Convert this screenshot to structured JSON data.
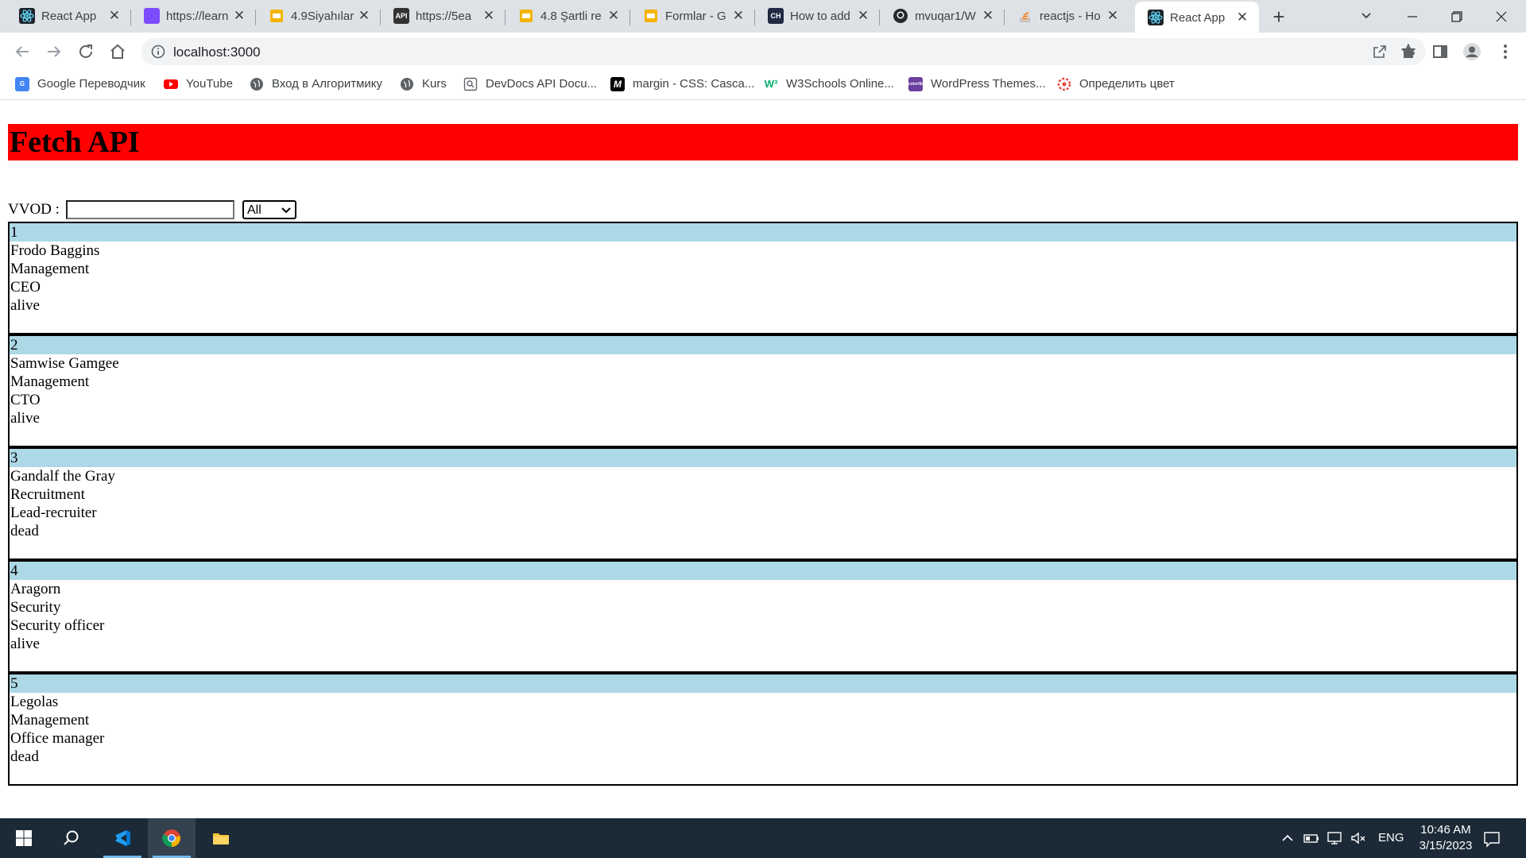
{
  "browser": {
    "tabs": [
      {
        "title": "React App",
        "favicon": "react-icon",
        "color": "#20232a"
      },
      {
        "title": "https://learn",
        "favicon": "purple-square-icon",
        "color": "#7c4dff"
      },
      {
        "title": "4.9Siyahılar",
        "favicon": "google-slides-icon",
        "color": "#f4b400"
      },
      {
        "title": "https://5ea",
        "favicon": "mock-api-icon",
        "color": "#333333"
      },
      {
        "title": "4.8 Şartli re",
        "favicon": "google-slides-icon",
        "color": "#f4b400"
      },
      {
        "title": "Formlar - G",
        "favicon": "google-slides-icon",
        "color": "#f4b400"
      },
      {
        "title": "How to add",
        "favicon": "ch-icon",
        "color": "#1f2a44"
      },
      {
        "title": "mvuqar1/W",
        "favicon": "github-icon",
        "color": "#24292e"
      },
      {
        "title": "reactjs - Ho",
        "favicon": "stackoverflow-icon",
        "color": "#f48024"
      },
      {
        "title": "React App",
        "favicon": "react-icon",
        "color": "#20232a",
        "active": true
      }
    ],
    "address_bar": {
      "url": "localhost:3000"
    },
    "bookmarks": [
      {
        "label": "Google Переводчик",
        "icon": "google-translate-icon",
        "color": "#4285f4"
      },
      {
        "label": "YouTube",
        "icon": "youtube-icon",
        "color": "#ff0000"
      },
      {
        "label": "Вход в Алгоритмику",
        "icon": "globe-icon",
        "color": "#5f6368"
      },
      {
        "label": "Kurs",
        "icon": "globe-icon",
        "color": "#5f6368"
      },
      {
        "label": "DevDocs API Docu...",
        "icon": "devdocs-icon",
        "color": "#5f6368"
      },
      {
        "label": "margin - CSS: Casca...",
        "icon": "mdn-icon",
        "color": "#000000"
      },
      {
        "label": "W3Schools Online...",
        "icon": "w3schools-icon",
        "color": "#04aa6d"
      },
      {
        "label": "WordPress Themes...",
        "icon": "colorlib-icon",
        "color": "#6a3f9e"
      },
      {
        "label": "Определить цвет",
        "icon": "color-picker-icon",
        "color": "#e8453c"
      }
    ]
  },
  "page": {
    "title": "Fetch API",
    "title_bg": "#ff0000",
    "filter": {
      "label": "VVOD :",
      "input_value": "",
      "select_value": "All"
    },
    "card_header_bg": "#add8e6",
    "employees": [
      {
        "id": "1",
        "name": "Frodo Baggins",
        "department": "Management",
        "position": "CEO",
        "status": "alive"
      },
      {
        "id": "2",
        "name": "Samwise Gamgee",
        "department": "Management",
        "position": "CTO",
        "status": "alive"
      },
      {
        "id": "3",
        "name": "Gandalf the Gray",
        "department": "Recruitment",
        "position": "Lead-recruiter",
        "status": "dead"
      },
      {
        "id": "4",
        "name": "Aragorn",
        "department": "Security",
        "position": "Security officer",
        "status": "alive"
      },
      {
        "id": "5",
        "name": "Legolas",
        "department": "Management",
        "position": "Office manager",
        "status": "dead"
      }
    ]
  },
  "taskbar": {
    "apps": [
      "start-icon",
      "search-icon",
      "vscode-icon",
      "chrome-icon",
      "file-explorer-icon"
    ],
    "language": "ENG",
    "time": "10:46 AM",
    "date": "3/15/2023"
  }
}
